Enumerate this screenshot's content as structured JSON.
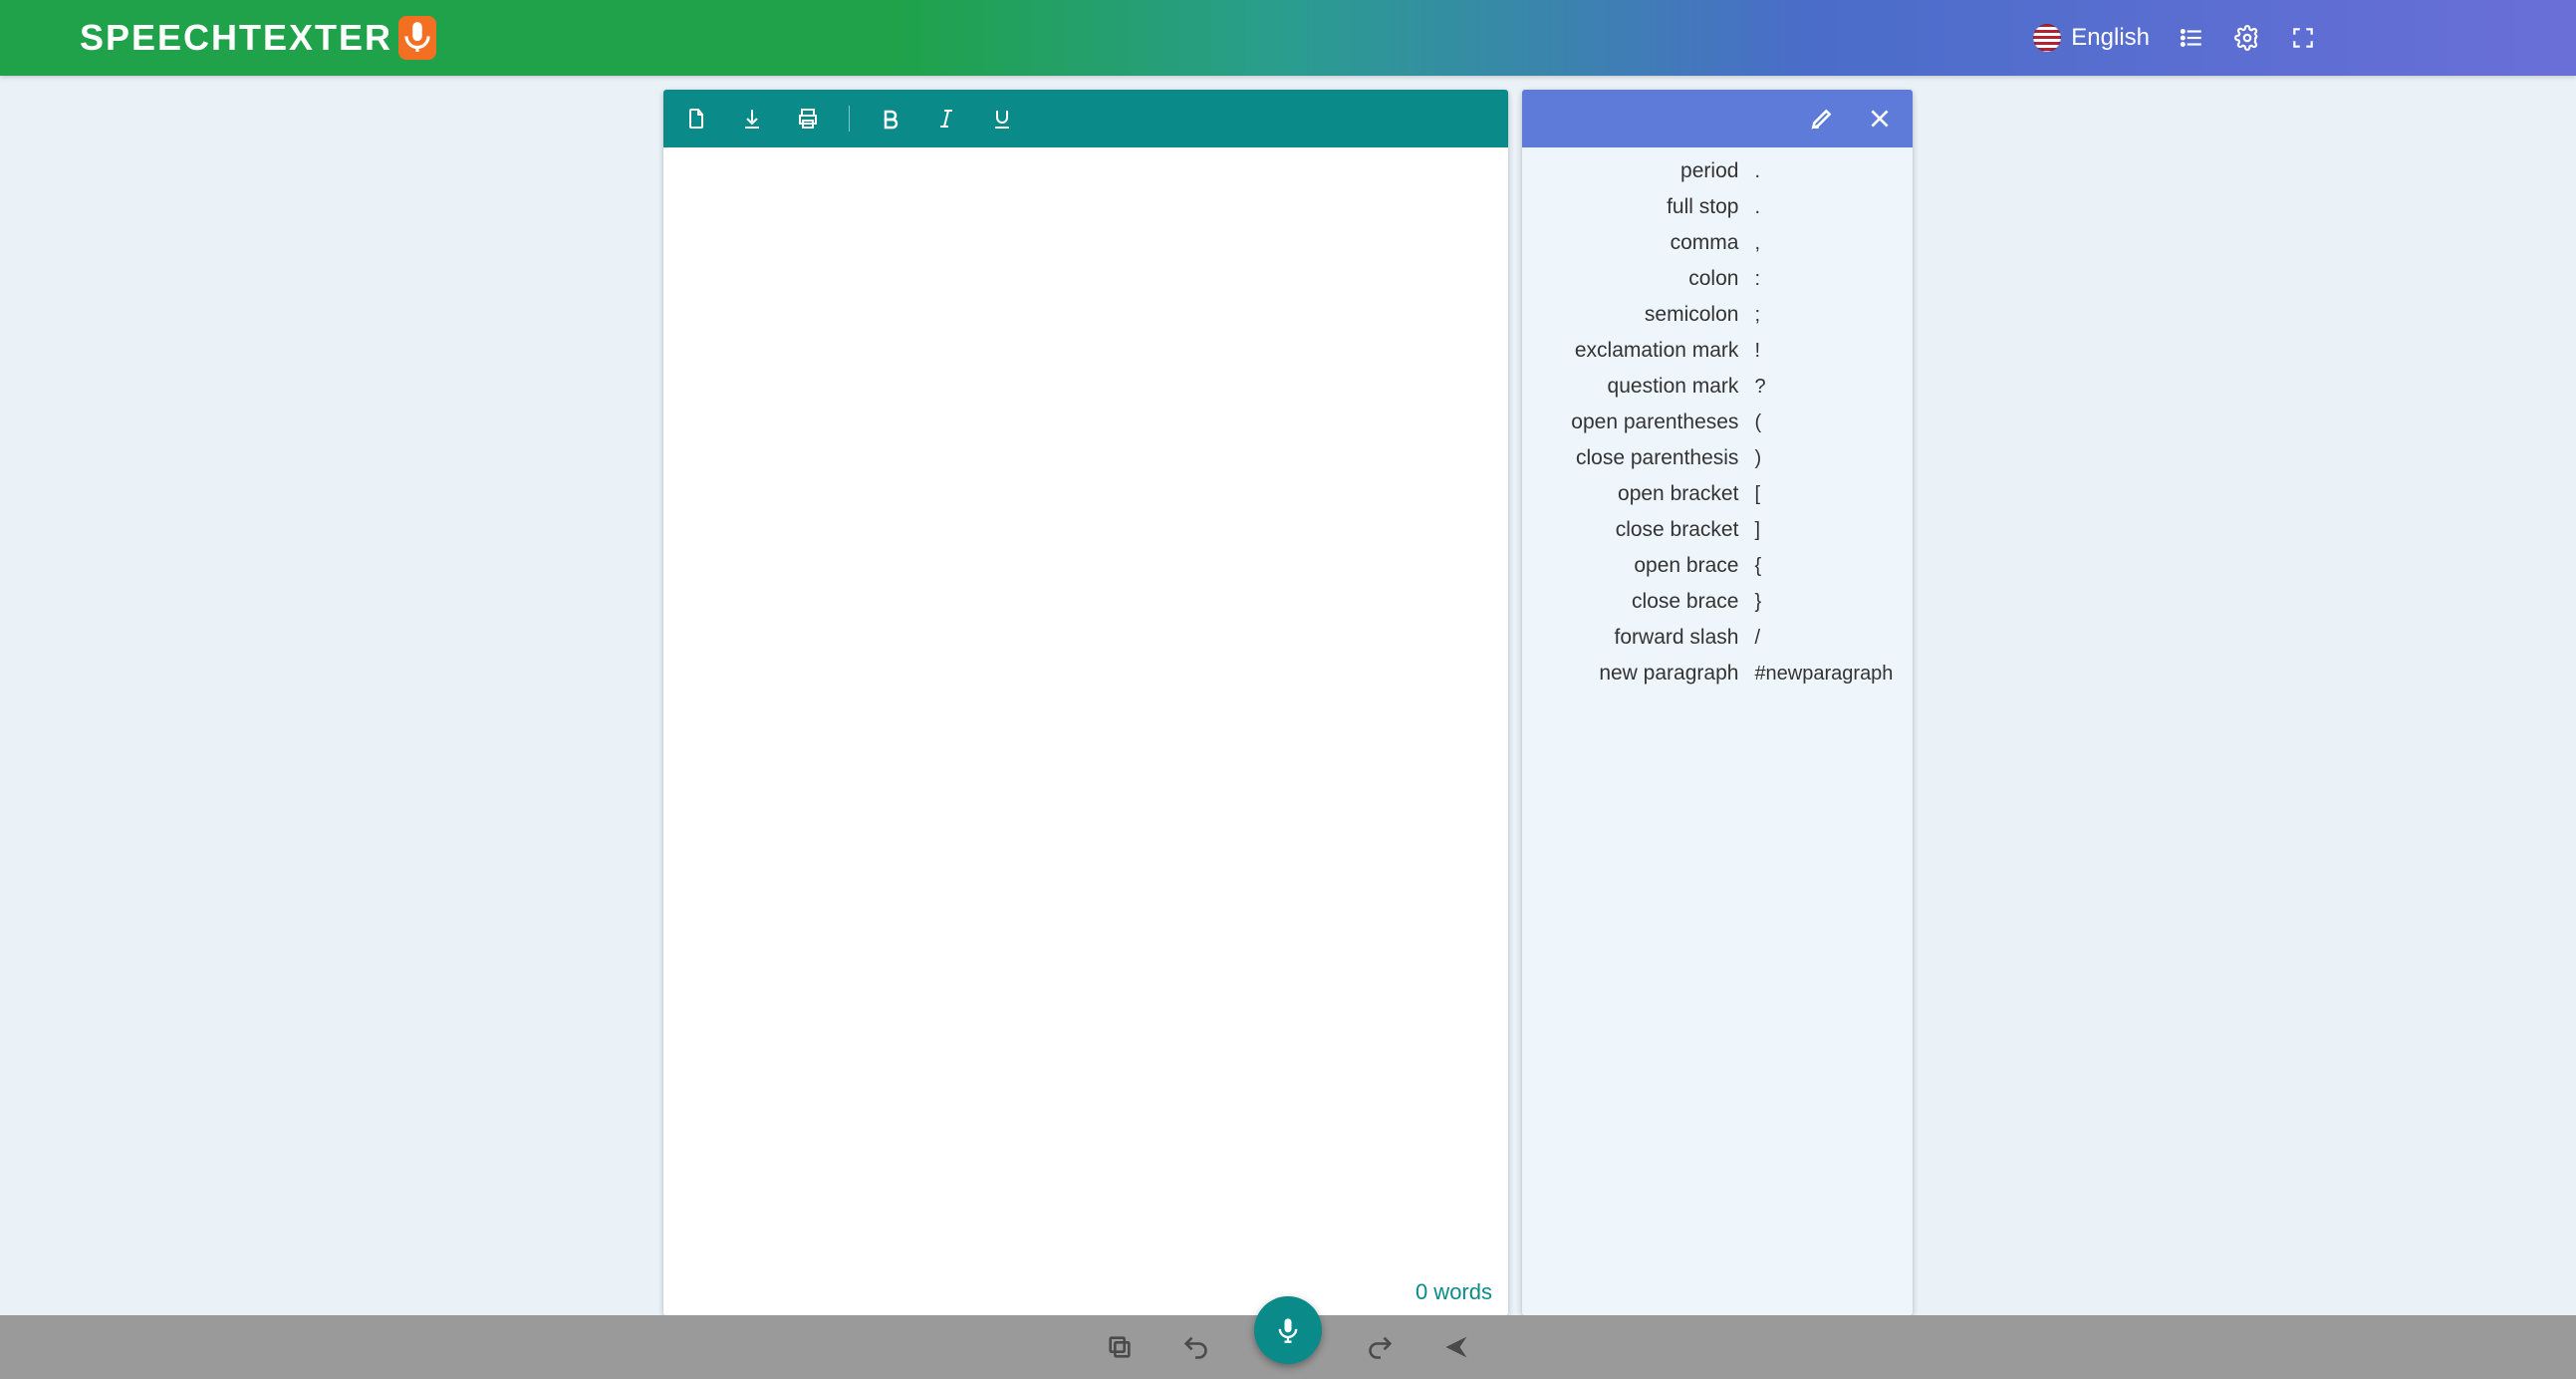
{
  "app": {
    "brand": "SPEECHTEXTER",
    "language": "English"
  },
  "editor": {
    "word_count": "0 words",
    "content": ""
  },
  "commands": [
    {
      "name": "period",
      "symbol": "."
    },
    {
      "name": "full stop",
      "symbol": "."
    },
    {
      "name": "comma",
      "symbol": ","
    },
    {
      "name": "colon",
      "symbol": ":"
    },
    {
      "name": "semicolon",
      "symbol": ";"
    },
    {
      "name": "exclamation mark",
      "symbol": "!"
    },
    {
      "name": "question mark",
      "symbol": "?"
    },
    {
      "name": "open parentheses",
      "symbol": "("
    },
    {
      "name": "close parenthesis",
      "symbol": ")"
    },
    {
      "name": "open bracket",
      "symbol": "["
    },
    {
      "name": "close bracket",
      "symbol": "]"
    },
    {
      "name": "open brace",
      "symbol": "{"
    },
    {
      "name": "close brace",
      "symbol": "}"
    },
    {
      "name": "forward slash",
      "symbol": "/"
    },
    {
      "name": "new paragraph",
      "symbol": "#newparagraph"
    }
  ]
}
